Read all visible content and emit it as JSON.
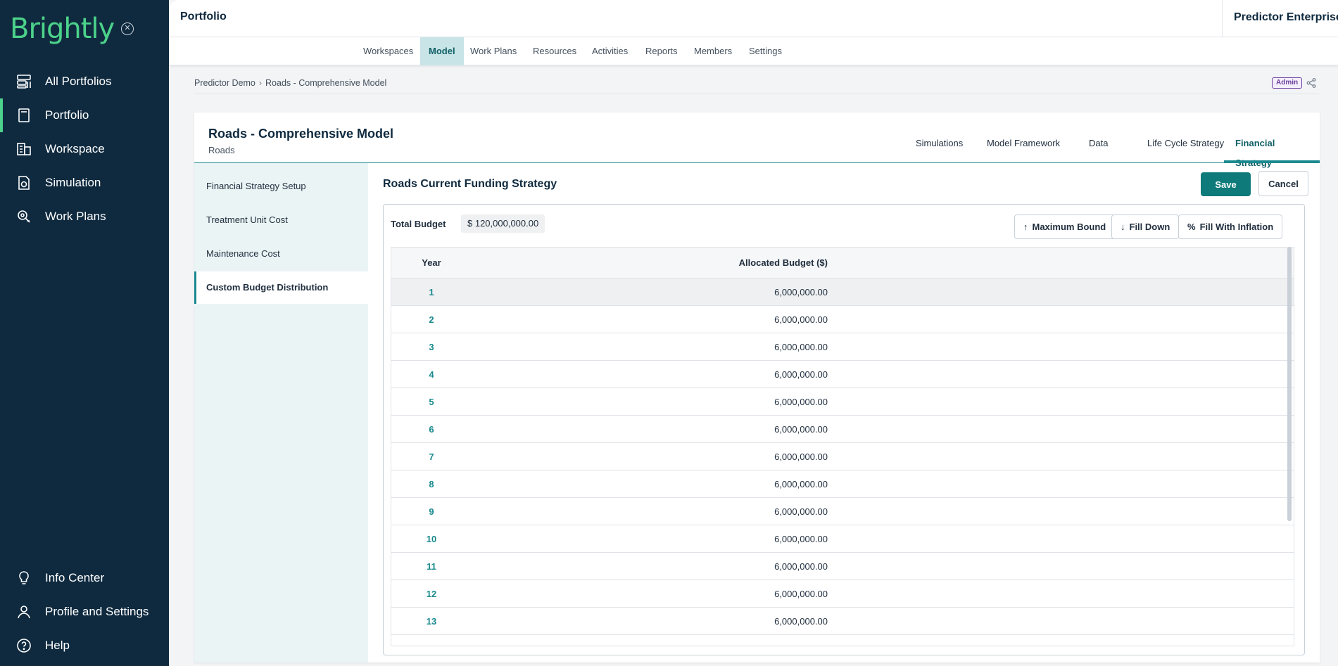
{
  "sidebar": {
    "logo": "Brightly",
    "top_items": [
      {
        "label": "All Portfolios",
        "icon": "portfolios-icon"
      },
      {
        "label": "Portfolio",
        "icon": "portfolio-book-icon"
      },
      {
        "label": "Workspace",
        "icon": "workspace-icon"
      },
      {
        "label": "Simulation",
        "icon": "simulation-icon"
      },
      {
        "label": "Work Plans",
        "icon": "work-plans-icon"
      }
    ],
    "bottom_items": [
      {
        "label": "Info Center",
        "icon": "lightbulb-icon"
      },
      {
        "label": "Profile and Settings",
        "icon": "user-icon"
      },
      {
        "label": "Help",
        "icon": "help-icon"
      }
    ],
    "active": "Portfolio",
    "accent": "#4cd28a",
    "background": "#0f2a3f"
  },
  "topbar": {
    "title": "Portfolio",
    "product": "Predictor Enterprise"
  },
  "menu": {
    "items": [
      "Workspaces",
      "Model",
      "Work Plans",
      "Resources",
      "Activities",
      "Reports",
      "Members",
      "Settings"
    ],
    "active": "Model"
  },
  "breadcrumb": {
    "items": [
      "Predictor Demo",
      "Roads - Comprehensive Model"
    ],
    "badge": "Admin"
  },
  "model": {
    "title": "Roads - Comprehensive Model",
    "subtitle": "Roads",
    "tabs": [
      "Simulations",
      "Model Framework",
      "Data",
      "Life Cycle Strategy",
      "Financial Strategy"
    ],
    "active_tab": "Financial Strategy"
  },
  "leftnav": {
    "items": [
      "Financial Strategy Setup",
      "Treatment Unit Cost",
      "Maintenance Cost",
      "Custom Budget Distribution"
    ],
    "active": "Custom Budget Distribution"
  },
  "strategy": {
    "title": "Roads Current Funding Strategy",
    "save_label": "Save",
    "cancel_label": "Cancel",
    "total_budget_label": "Total Budget",
    "total_budget_value": "$ 120,000,000.00",
    "tools": [
      "Maximum Bound",
      "Fill Down",
      "Fill With Inflation"
    ]
  },
  "table": {
    "columns": [
      "Year",
      "Allocated Budget ($)"
    ],
    "rows": [
      {
        "year": "1",
        "budget": "6,000,000.00"
      },
      {
        "year": "2",
        "budget": "6,000,000.00"
      },
      {
        "year": "3",
        "budget": "6,000,000.00"
      },
      {
        "year": "4",
        "budget": "6,000,000.00"
      },
      {
        "year": "5",
        "budget": "6,000,000.00"
      },
      {
        "year": "6",
        "budget": "6,000,000.00"
      },
      {
        "year": "7",
        "budget": "6,000,000.00"
      },
      {
        "year": "8",
        "budget": "6,000,000.00"
      },
      {
        "year": "9",
        "budget": "6,000,000.00"
      },
      {
        "year": "10",
        "budget": "6,000,000.00"
      },
      {
        "year": "11",
        "budget": "6,000,000.00"
      },
      {
        "year": "12",
        "budget": "6,000,000.00"
      },
      {
        "year": "13",
        "budget": "6,000,000.00"
      }
    ],
    "selected_row": "1"
  }
}
